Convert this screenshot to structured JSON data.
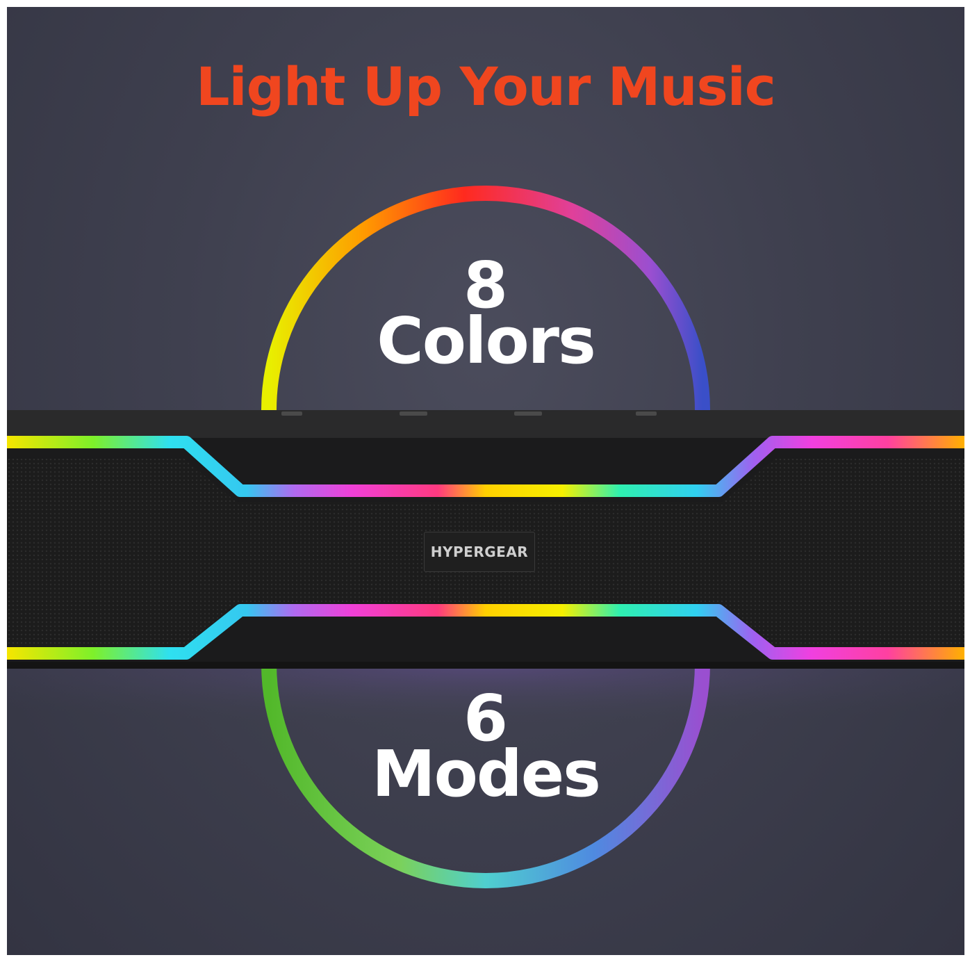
{
  "headline": "Light Up Your Music",
  "colors_stat": {
    "number": "8",
    "label": "Colors"
  },
  "modes_stat": {
    "number": "6",
    "label": "Modes"
  },
  "brand": "HYPERGEAR",
  "accent_color": "#f0461f",
  "text_color": "#ffffff",
  "background_color": "#40414f"
}
